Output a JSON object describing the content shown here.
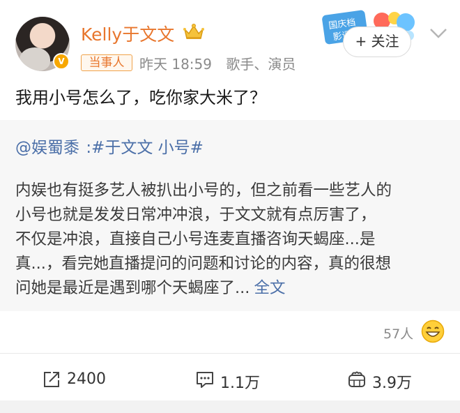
{
  "header": {
    "username": "Kelly于文文",
    "tag": "当事人",
    "time": "昨天 18:59",
    "profession": "歌手、演员",
    "follow_label": "+ 关注",
    "banner_text": "国庆档 影评"
  },
  "post": {
    "text": "我用小号怎么了，吃你家大米了？"
  },
  "repost": {
    "source": "@娱蜀黍",
    "topic": ":#于文文 小号#",
    "lines": [
      "内娱也有挺多艺人被扒出小号的，但之前看一些艺人的",
      "小号也就是发发日常冲冲浪，于文文就有点厉害了，",
      "不仅是冲浪，直接自己小号连麦直播咨询天蝎座...是",
      "真...，看完她直播提问的问题和讨论的内容，真的很想",
      "问她是最近是遇到哪个天蝎座了..."
    ],
    "full_text_label": "全文"
  },
  "stats": {
    "likes_people": "57人"
  },
  "actions": {
    "repost_count": "2400",
    "comment_count": "1.1万",
    "like_count": "3.9万"
  },
  "colors": {
    "accent": "#e8762d",
    "link": "#4b6fa8",
    "muted": "#8a8a8a"
  }
}
